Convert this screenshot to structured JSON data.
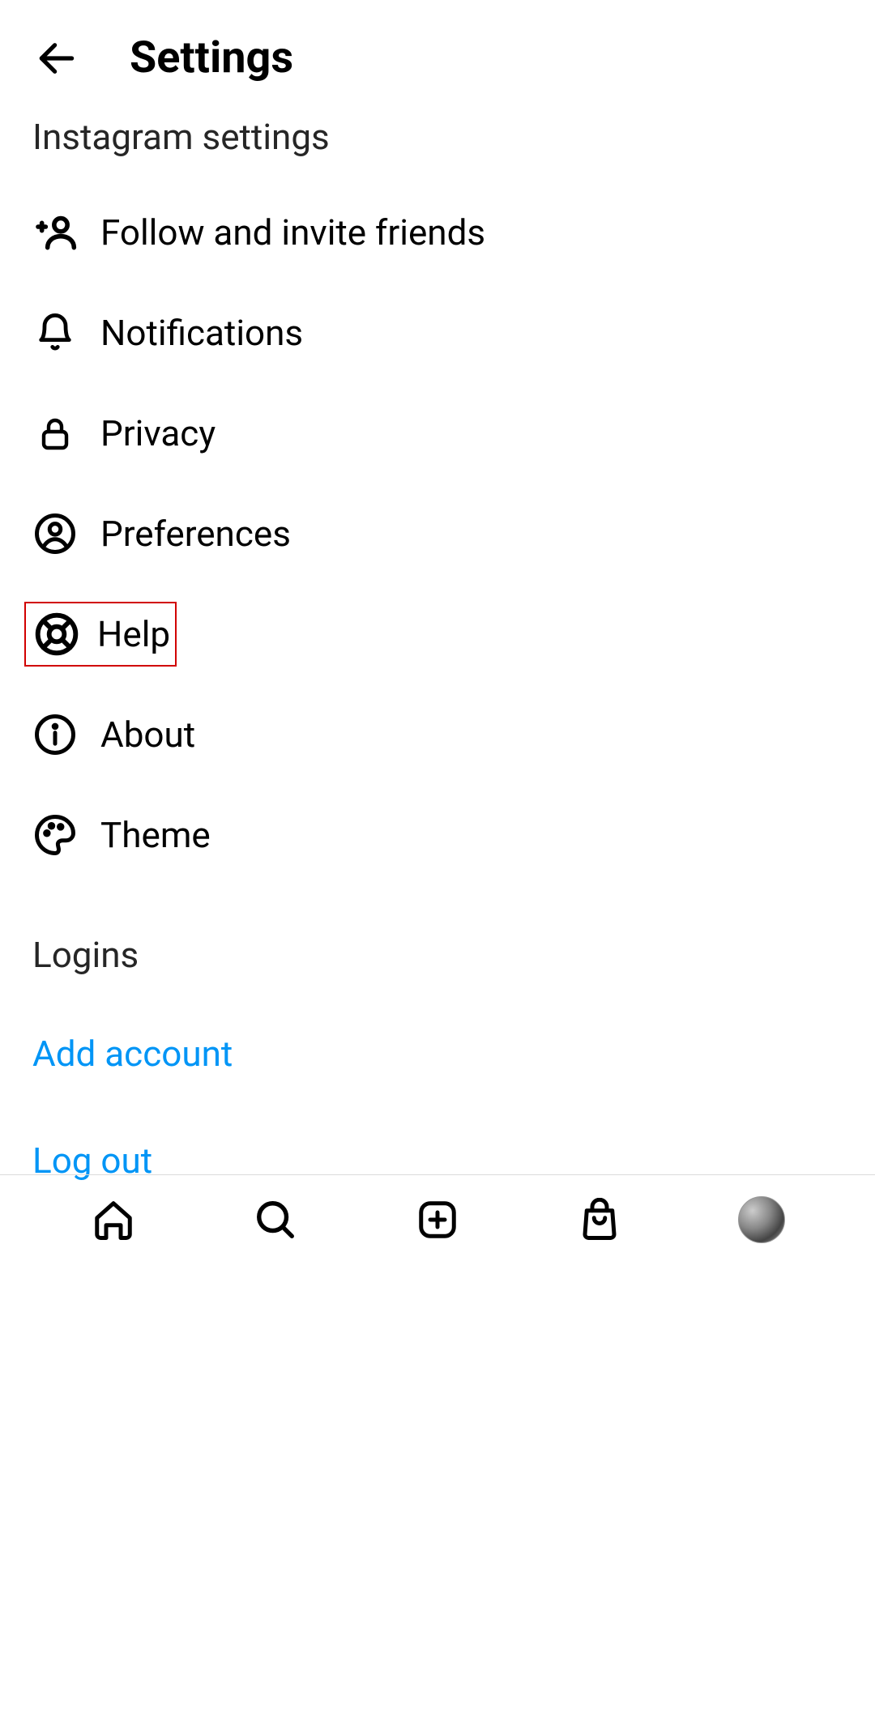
{
  "header": {
    "title": "Settings"
  },
  "subtitle": "Instagram settings",
  "menu": {
    "items": [
      {
        "label": "Follow and invite friends"
      },
      {
        "label": "Notifications"
      },
      {
        "label": "Privacy"
      },
      {
        "label": "Preferences"
      },
      {
        "label": "Help"
      },
      {
        "label": "About"
      },
      {
        "label": "Theme"
      }
    ]
  },
  "logins": {
    "heading": "Logins",
    "add_account": "Add account",
    "log_out": "Log out"
  },
  "colors": {
    "link": "#0095f6",
    "highlight_border": "#d10000"
  }
}
